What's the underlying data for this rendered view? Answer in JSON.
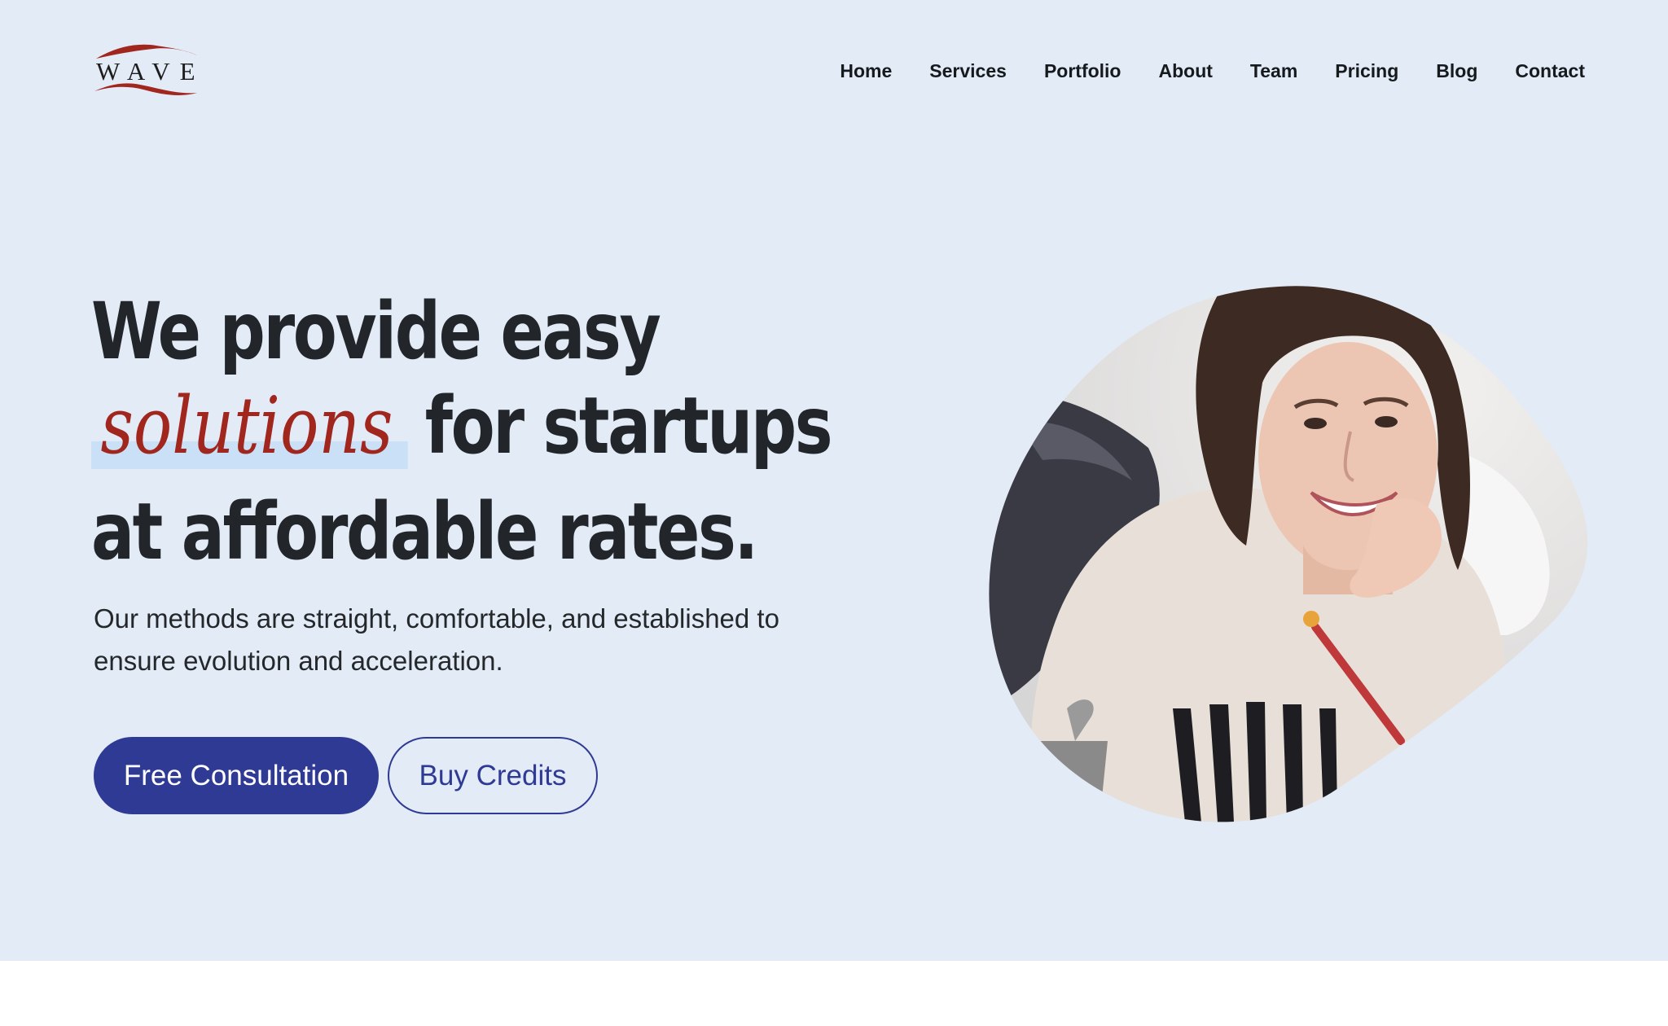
{
  "brand": {
    "logo_text": "WAVE",
    "accent_color": "#a0261e"
  },
  "nav": {
    "items": [
      {
        "label": "Home"
      },
      {
        "label": "Services"
      },
      {
        "label": "Portfolio"
      },
      {
        "label": "About"
      },
      {
        "label": "Team"
      },
      {
        "label": "Pricing"
      },
      {
        "label": "Blog"
      },
      {
        "label": "Contact"
      }
    ]
  },
  "hero": {
    "headline_line1": "We provide easy",
    "headline_script": "solutions",
    "headline_line2_rest": "for startups",
    "headline_line3": "at affordable rates.",
    "subtext": "Our methods are straight, comfortable, and established to ensure evolution and acceleration.",
    "primary_button": "Free Consultation",
    "secondary_button": "Buy Credits",
    "background_color": "#e3ebf7",
    "button_color": "#2f3a94"
  }
}
